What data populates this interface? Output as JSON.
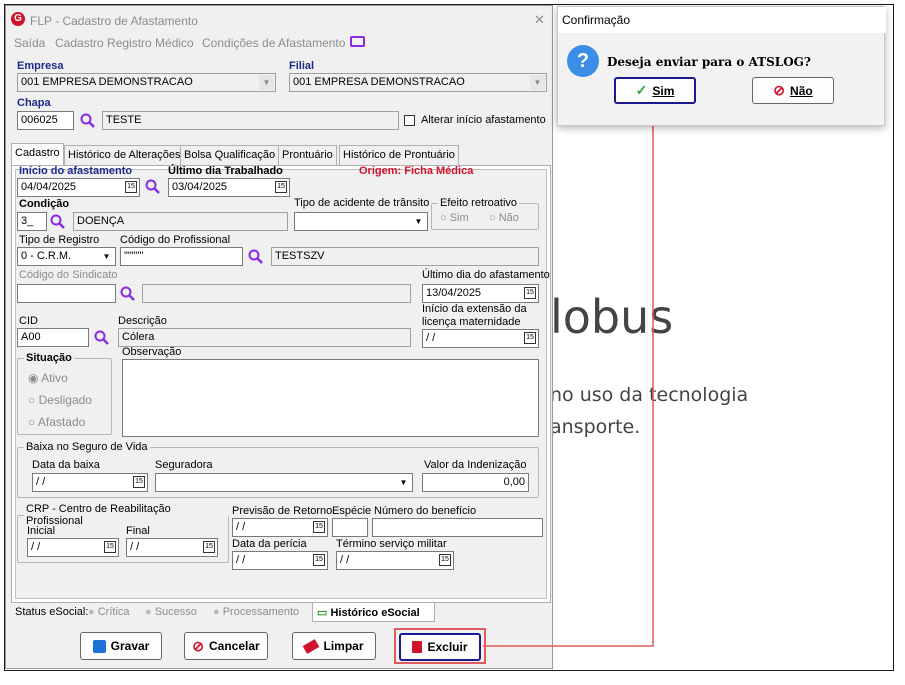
{
  "window": {
    "title": "FLP - Cadastro de Afastamento",
    "close": "✕"
  },
  "menu": {
    "items": [
      "Saída",
      "Cadastro Registro Médico",
      "Condições de Afastamento"
    ]
  },
  "empresa": {
    "label": "Empresa",
    "value": "001 EMPRESA DEMONSTRACAO"
  },
  "filial": {
    "label": "Filial",
    "value": "001 EMPRESA DEMONSTRACAO"
  },
  "chapa": {
    "label": "Chapa",
    "value": "006025",
    "name": "TESTE",
    "alterar": "Alterar início afastamento"
  },
  "tabs": [
    "Cadastro",
    "Histórico de Alterações",
    "Bolsa Qualificação",
    "Prontuário",
    "Histórico de Prontuário"
  ],
  "form": {
    "inicio_label": "Início do afastamento",
    "inicio": "04/04/2025",
    "ultimo_label": "Último dia Trabalhado",
    "ultimo": "03/04/2025",
    "origem": "Origem: Ficha Médica",
    "condicao_label": "Condição",
    "condicao_code": "3_",
    "condicao_desc": "DOENÇA",
    "acidente_label": "Tipo de acidente de trânsito",
    "efeito_label": "Efeito retroativo",
    "efeito_sim": "Sim",
    "efeito_nao": "Não",
    "tipo_reg_label": "Tipo de Registro",
    "tipo_reg": "0 - C.R.M.",
    "cod_prof_label": "Código do Profissional",
    "cod_prof": "\"\"\"\"\"",
    "prof_name": "TESTSZV",
    "sindicato_label": "Código do Sindicato",
    "ultimo_afast_label": "Último dia do afastamento",
    "ultimo_afast": "13/04/2025",
    "cid_label": "CID",
    "cid": "A00",
    "desc_label": "Descrição",
    "desc": "Cólera",
    "ext_label1": "Início da extensão da",
    "ext_label2": "licença maternidade",
    "ext": " / /",
    "situacao_label": "Situação",
    "sit_ativo": "Ativo",
    "sit_desligado": "Desligado",
    "sit_afastado": "Afastado",
    "obs_label": "Observação",
    "baixa_label": "Baixa no Seguro de Vida",
    "data_baixa_label": "Data da baixa",
    "data_baixa": " / /",
    "seguradora_label": "Seguradora",
    "valor_label": "Valor da Indenização",
    "valor": "0,00",
    "crp_label": "CRP - Centro de Reabilitação Profissional",
    "inicial_label": "Inicial",
    "inicial": " / /",
    "final_label": "Final",
    "final": " / /",
    "prev_label": "Previsão de Retorno",
    "prev": " / /",
    "especie_label": "Espécie",
    "num_label": "Número do benefício",
    "pericia_label": "Data da perícia",
    "pericia": " / /",
    "termino_label": "Término serviço militar",
    "termino": " / /"
  },
  "status": {
    "label": "Status eSocial:",
    "critica": "Crítica",
    "sucesso": "Sucesso",
    "processamento": "Processamento",
    "historico": "Histórico eSocial"
  },
  "buttons": {
    "gravar": "Gravar",
    "cancelar": "Cancelar",
    "limpar": "Limpar",
    "excluir": "Excluir"
  },
  "dialog": {
    "title": "Confirmação",
    "message": "Deseja enviar para o ATSLOG?",
    "sim": "Sim",
    "nao": "Não"
  },
  "background": {
    "line1": "lobus",
    "line2": "no uso da tecnologia",
    "line3": "ansporte."
  }
}
